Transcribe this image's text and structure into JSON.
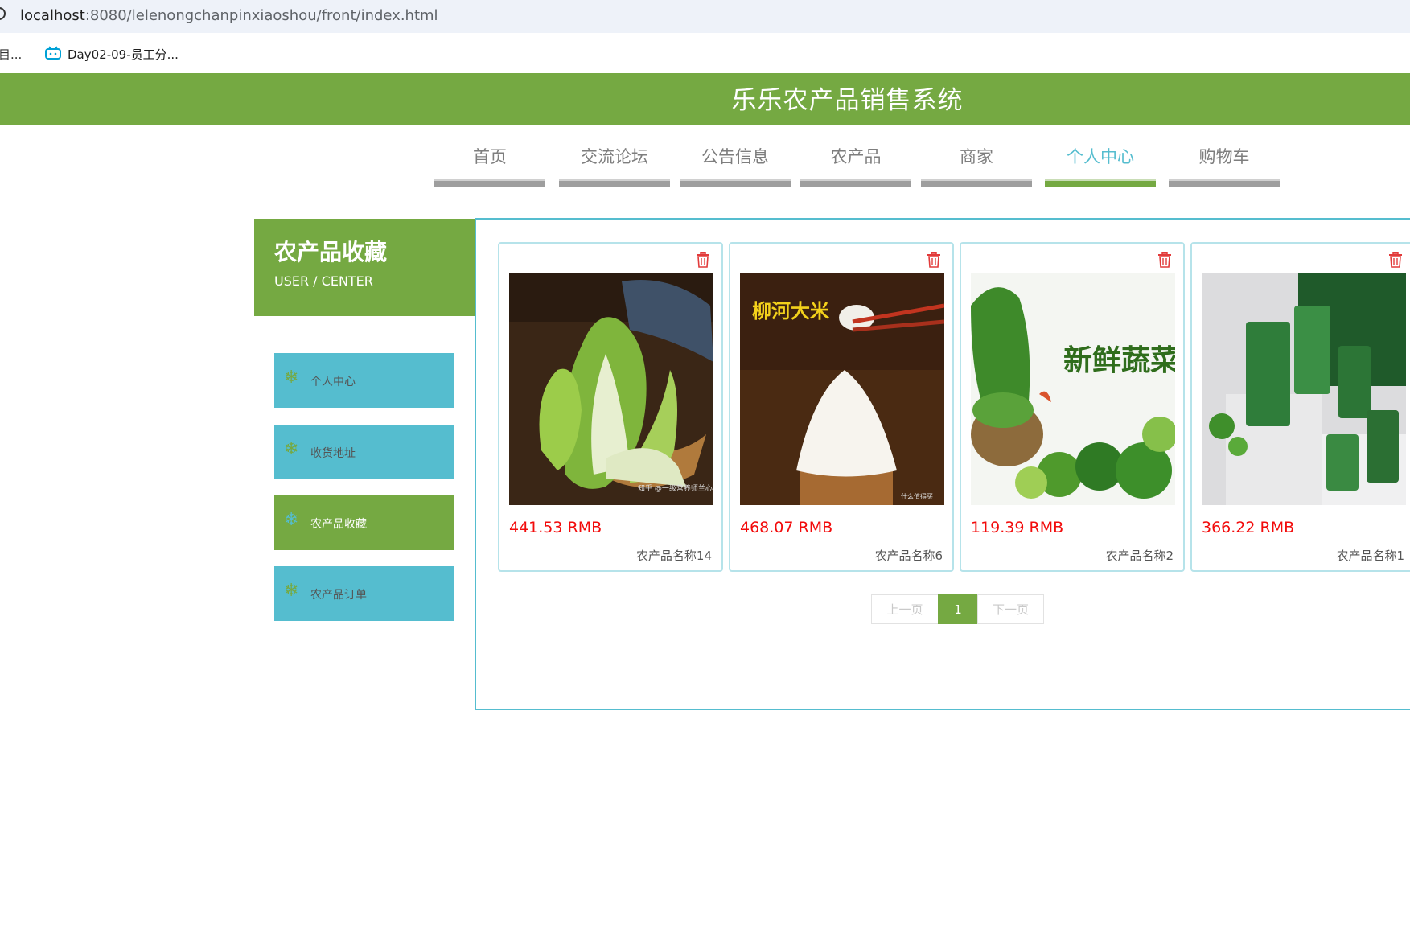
{
  "browser": {
    "url_host": "localhost",
    "url_path": ":8080/lelenongchanpinxiaoshou/front/index.html",
    "bookmark_trunc": "目...",
    "bookmark_label": "Day02-09-员工分..."
  },
  "site": {
    "title": "乐乐农产品销售系统"
  },
  "nav": {
    "items": [
      "首页",
      "交流论坛",
      "公告信息",
      "农产品",
      "商家",
      "个人中心",
      "购物车"
    ],
    "active": "个人中心"
  },
  "sidebar": {
    "title": "农产品收藏",
    "subtitle": "USER / CENTER",
    "items": [
      "个人中心",
      "收货地址",
      "农产品收藏",
      "农产品订单"
    ],
    "active": "农产品收藏"
  },
  "favorites": [
    {
      "price": "441.53 RMB",
      "name": "农产品名称14",
      "image": "chinese-cabbage-photo",
      "watermark": "知乎 @一级营养师兰心"
    },
    {
      "price": "468.07 RMB",
      "name": "农产品名称6",
      "image": "rice-photo",
      "overlay_text": "柳河大米",
      "watermark": "什么值得买"
    },
    {
      "price": "119.39 RMB",
      "name": "农产品名称2",
      "image": "fresh-vegetables-banner",
      "overlay_text": "新鲜蔬菜"
    },
    {
      "price": "366.22 RMB",
      "name": "农产品名称1",
      "image": "packaged-greens-photo"
    }
  ],
  "pagination": {
    "prev": "上一页",
    "current": "1",
    "next": "下一页"
  },
  "colors": {
    "green": "#75a942",
    "teal": "#55bdcf",
    "price_red": "#f20b0b"
  }
}
